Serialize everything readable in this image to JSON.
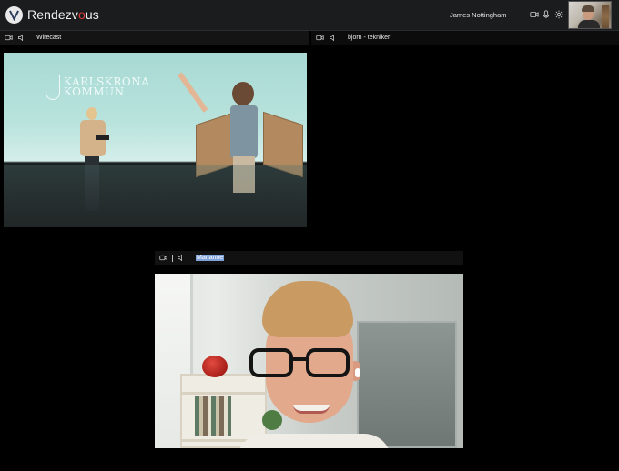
{
  "app": {
    "brand_prefix": "Rendezv",
    "brand_accent": "o",
    "brand_suffix": "us",
    "accent_color": "#e23b3b"
  },
  "header": {
    "user_name": "James Nottingham",
    "icons": [
      "camera-icon",
      "microphone-icon",
      "settings-icon"
    ]
  },
  "participants": [
    {
      "name": "Wirecast",
      "icons": [
        "camera-icon",
        "speaker-icon"
      ]
    },
    {
      "name": "björn - tekniker",
      "icons": [
        "camera-icon",
        "speaker-icon"
      ]
    },
    {
      "name": "Marianne",
      "icons": [
        "camera-icon",
        "speaker-icon"
      ],
      "name_selected": true
    }
  ],
  "wirecast_video": {
    "logo_line1": "KARLSKRONA",
    "logo_line2": "KOMMUN"
  }
}
